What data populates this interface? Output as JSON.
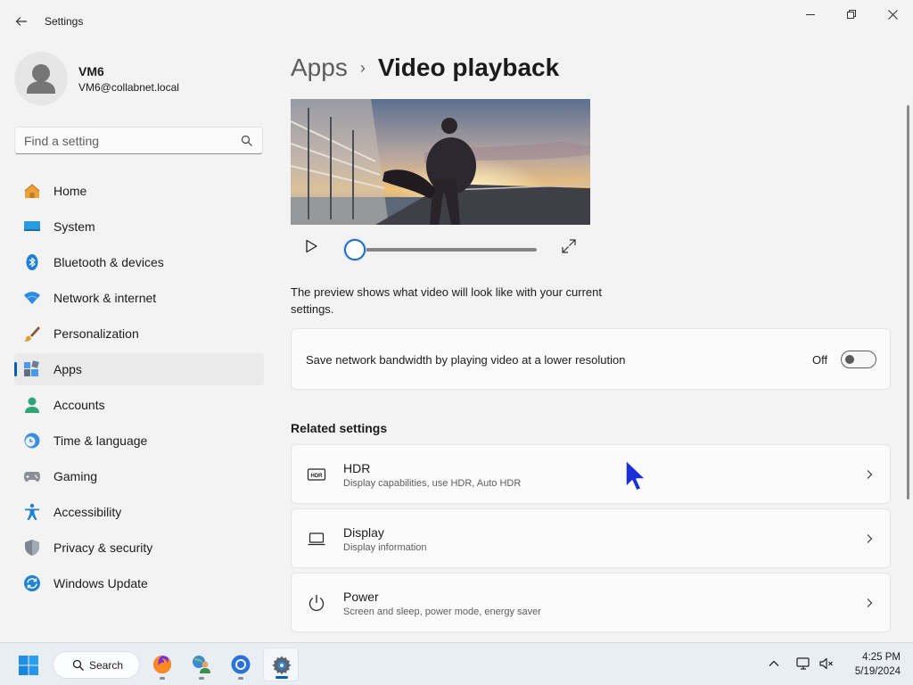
{
  "window": {
    "app_title": "Settings"
  },
  "profile": {
    "name": "VM6",
    "email": "VM6@collabnet.local"
  },
  "search": {
    "placeholder": "Find a setting"
  },
  "nav": {
    "selected": "Apps",
    "items": [
      {
        "label": "Home",
        "icon": "home-icon"
      },
      {
        "label": "System",
        "icon": "system-icon"
      },
      {
        "label": "Bluetooth & devices",
        "icon": "bluetooth-icon"
      },
      {
        "label": "Network & internet",
        "icon": "wifi-icon"
      },
      {
        "label": "Personalization",
        "icon": "brush-icon"
      },
      {
        "label": "Apps",
        "icon": "apps-icon"
      },
      {
        "label": "Accounts",
        "icon": "accounts-icon"
      },
      {
        "label": "Time & language",
        "icon": "clock-globe-icon"
      },
      {
        "label": "Gaming",
        "icon": "gamepad-icon"
      },
      {
        "label": "Accessibility",
        "icon": "accessibility-icon"
      },
      {
        "label": "Privacy & security",
        "icon": "shield-icon"
      },
      {
        "label": "Windows Update",
        "icon": "update-icon"
      }
    ]
  },
  "breadcrumb": {
    "parent": "Apps",
    "separator": "›",
    "current": "Video playback"
  },
  "player": {
    "position": 0,
    "description": "The preview shows what video will look like with your current settings."
  },
  "bandwidth": {
    "label": "Save network bandwidth by playing video at a lower resolution",
    "state": "Off",
    "enabled": false
  },
  "related": {
    "heading": "Related settings",
    "items": [
      {
        "title": "HDR",
        "subtitle": "Display capabilities, use HDR, Auto HDR",
        "icon": "hdr-icon"
      },
      {
        "title": "Display",
        "subtitle": "Display information",
        "icon": "display-icon"
      },
      {
        "title": "Power",
        "subtitle": "Screen and sleep, power mode, energy saver",
        "icon": "power-icon"
      }
    ]
  },
  "taskbar": {
    "search_label": "Search",
    "apps": [
      "firefox-icon",
      "people-globe-icon",
      "chrome-icon",
      "settings-gear-icon"
    ],
    "active_app": "settings-gear-icon",
    "time": "4:25 PM",
    "date": "5/19/2024"
  },
  "colors": {
    "accent": "#005fb8",
    "background": "#f3f3f3",
    "card": "#fbfbfb"
  }
}
